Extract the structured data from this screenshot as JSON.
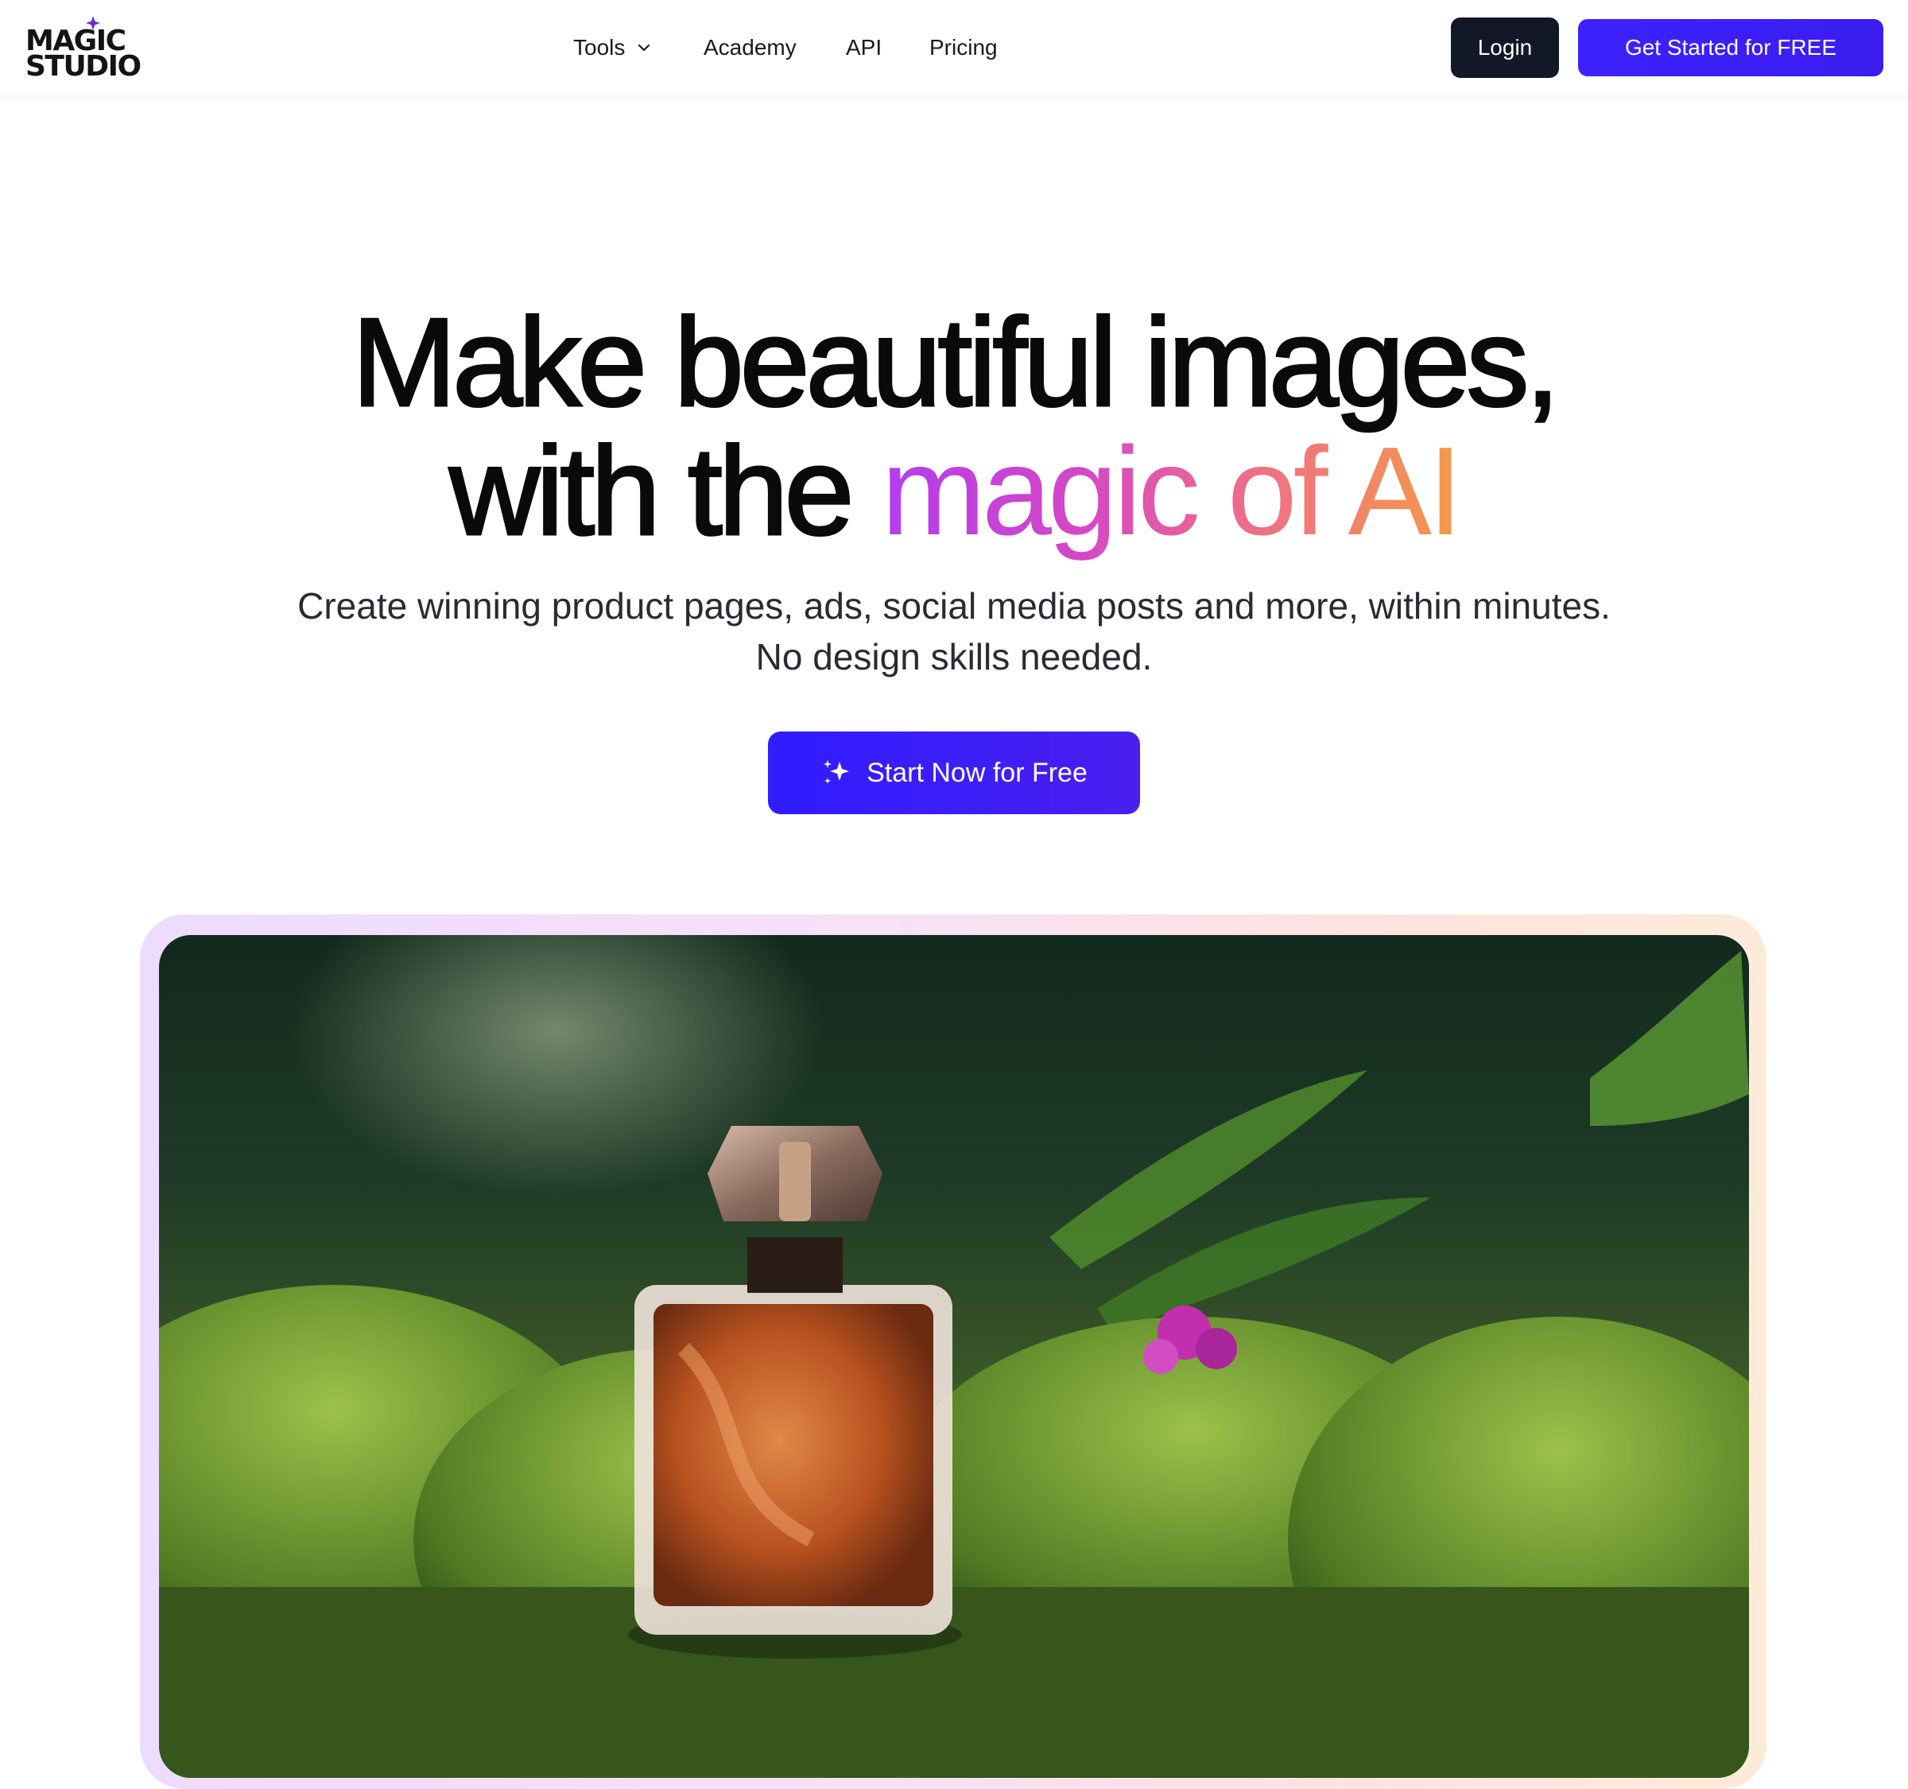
{
  "header": {
    "logo": {
      "line1": "MAGIC",
      "line2": "STUDIO",
      "icon": "sparkle-star-icon"
    },
    "nav": [
      {
        "label": "Tools",
        "has_dropdown": true
      },
      {
        "label": "Academy"
      },
      {
        "label": "API"
      },
      {
        "label": "Pricing"
      }
    ],
    "login_label": "Login",
    "get_started_label": "Get Started for FREE"
  },
  "hero": {
    "headline_line1": "Make beautiful images,",
    "headline_line2_plain": "with the",
    "headline_line2_gradient": "magic of AI",
    "subtitle_line1": "Create winning product pages, ads, social media posts and more, within minutes.",
    "subtitle_line2": "No design skills needed.",
    "cta_label": "Start Now for Free"
  },
  "colors": {
    "primary": "#3d22ff",
    "dark": "#121826",
    "gradient_start": "#b43cf0",
    "gradient_end": "#f39a4a"
  },
  "showcase": {
    "subject": "perfume bottle on moss"
  }
}
